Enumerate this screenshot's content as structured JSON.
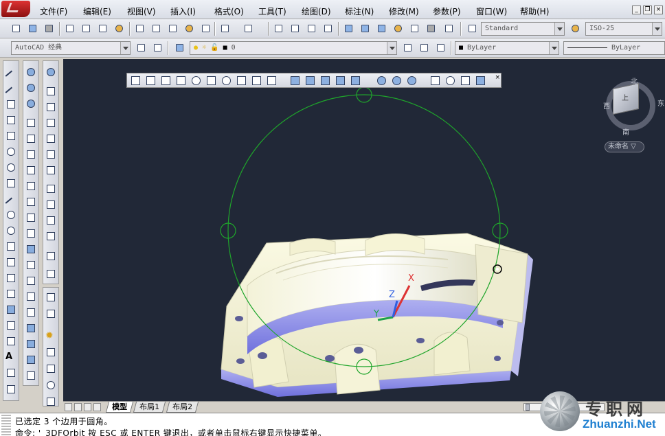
{
  "menu": {
    "items": [
      {
        "label": "文件(F)"
      },
      {
        "label": "编辑(E)"
      },
      {
        "label": "视图(V)"
      },
      {
        "label": "插入(I)"
      },
      {
        "label": "格式(O)"
      },
      {
        "label": "工具(T)"
      },
      {
        "label": "绘图(D)"
      },
      {
        "label": "标注(N)"
      },
      {
        "label": "修改(M)"
      },
      {
        "label": "参数(P)"
      },
      {
        "label": "窗口(W)"
      },
      {
        "label": "帮助(H)"
      }
    ]
  },
  "styles": {
    "text_style": "Standard",
    "dim_style": "ISO-25"
  },
  "workspace": {
    "name": "AutoCAD 经典",
    "layer_value": "0",
    "color_value": "ByLayer",
    "linetype_value": "ByLayer"
  },
  "navcube": {
    "label_top": "上",
    "label_north": "北",
    "label_east": "东",
    "label_west": "西",
    "label_south": "南",
    "view_menu": "未命名 ▽"
  },
  "ucs": {
    "x": "X",
    "y": "Y",
    "z": "Z"
  },
  "layout_tabs": [
    {
      "label": "模型",
      "active": true
    },
    {
      "label": "布局1",
      "active": false
    },
    {
      "label": "布局2",
      "active": false
    }
  ],
  "command": {
    "line1": "已选定 3 个边用于圆角。",
    "line2": "命令: '_3DFOrbit 按 ESC 或 ENTER 键退出，或者单击鼠标右键显示快捷菜单。"
  },
  "watermark": {
    "cn": "专职网",
    "url": "Zhuanzhi.Net"
  },
  "colors": {
    "canvas": "#212837",
    "orbit": "#1fa52b",
    "model_light": "#f6f4d4",
    "model_shadow": "#7d7ee6"
  }
}
